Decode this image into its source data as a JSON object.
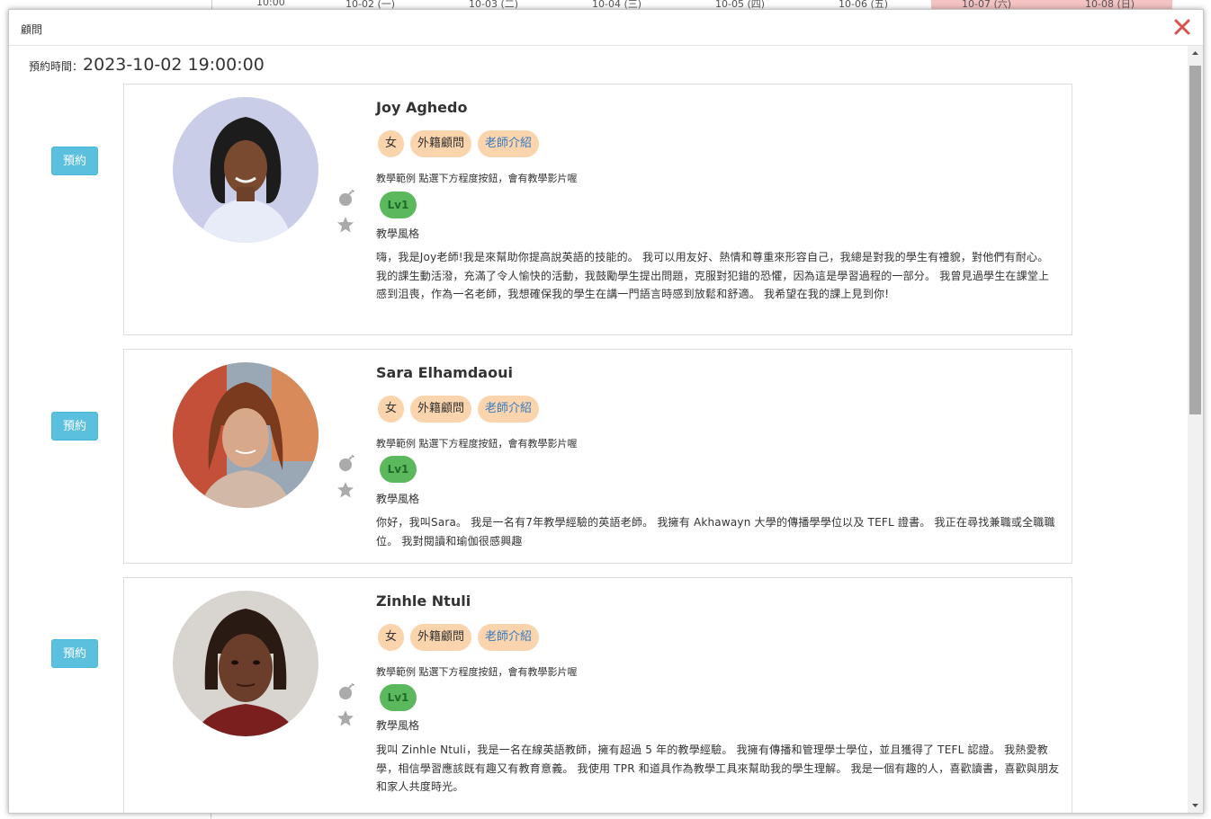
{
  "background": {
    "header_cells": [
      "10:00",
      "10-02 (一)",
      "10-03 (二)",
      "10-04 (三)",
      "10-05 (四)",
      "10-06 (五)",
      "10-07 (六)",
      "10-08 (日)"
    ]
  },
  "modal": {
    "title": "顧問",
    "close_icon": "close-icon",
    "time_label": "預約時間：",
    "time_value": "2023-10-02 19:00:00"
  },
  "teachers": [
    {
      "book_label": "預約",
      "name": "Joy Aghedo",
      "tags": [
        "女",
        "外籍顧問",
        "老師介紹"
      ],
      "sample_text": "教學範例 點選下方程度按鈕，會有教學影片喔",
      "level": "Lv1",
      "style_label": "教學風格",
      "description": "嗨，我是Joy老師!我是來幫助你提高說英語的技能的。 我可以用友好、熱情和尊重來形容自己，我總是對我的學生有禮貌，對他們有耐心。 我的課生動活潑，充滿了令人愉快的活動，我鼓勵學生提出問題，克服對犯錯的恐懼，因為這是學習過程的一部分。 我曾見過學生在課堂上感到沮喪，作為一名老師，我想確保我的學生在講一門語言時感到放鬆和舒適。 我希望在我的課上見到你!"
    },
    {
      "book_label": "預約",
      "name": "Sara Elhamdaoui",
      "tags": [
        "女",
        "外籍顧問",
        "老師介紹"
      ],
      "sample_text": "教學範例 點選下方程度按鈕，會有教學影片喔",
      "level": "Lv1",
      "style_label": "教學風格",
      "description": "你好，我叫Sara。 我是一名有7年教學經驗的英語老師。 我擁有 Akhawayn 大學的傳播學學位以及 TEFL 證書。 我正在尋找兼職或全職職位。 我對閱讀和瑜伽很感興趣"
    },
    {
      "book_label": "預約",
      "name": "Zinhle Ntuli",
      "tags": [
        "女",
        "外籍顧問",
        "老師介紹"
      ],
      "sample_text": "教學範例 點選下方程度按鈕，會有教學影片喔",
      "level": "Lv1",
      "style_label": "教學風格",
      "description": "我叫 Zinhle Ntuli，我是一名在線英語教師，擁有超過 5 年的教學經驗。 我擁有傳播和管理學士學位，並且獲得了 TEFL 認證。 我熱愛教學，相信學習應該既有趣又有教育意義。 我使用 TPR 和道具作為教學工具來幫助我的學生理解。 我是一個有趣的人，喜歡讀書，喜歡與朋友和家人共度時光。"
    }
  ],
  "colors": {
    "book_button": "#5bc0de",
    "tag_bg": "#fad4ad",
    "level_bg": "#5cb85c",
    "link_text": "#3a7bbf",
    "close_icon": "#d9534f"
  }
}
